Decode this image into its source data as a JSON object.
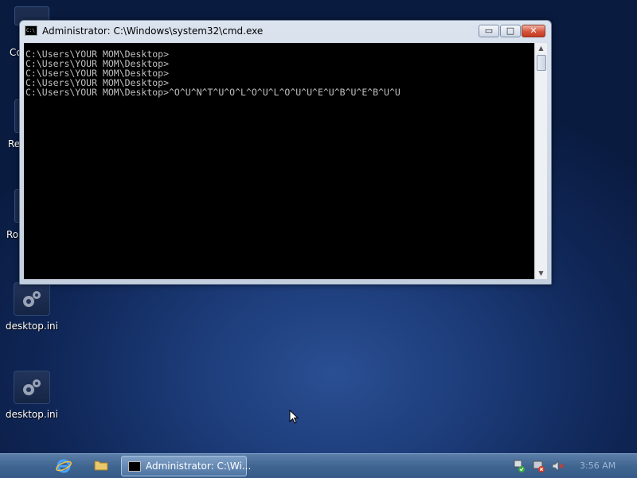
{
  "desktop": {
    "partial_labels": [
      "Co",
      "Re",
      "Ro"
    ],
    "icons": [
      {
        "label": "desktop.ini",
        "icon": "gear-icon"
      },
      {
        "label": "desktop.ini",
        "icon": "gear-icon"
      }
    ]
  },
  "window": {
    "title": "Administrator: C:\\Windows\\system32\\cmd.exe",
    "buttons": {
      "minimize": "▭",
      "maximize": "□",
      "close": "✕"
    },
    "console_lines": [
      "C:\\Users\\YOUR MOM\\Desktop>",
      "C:\\Users\\YOUR MOM\\Desktop>",
      "C:\\Users\\YOUR MOM\\Desktop>",
      "C:\\Users\\YOUR MOM\\Desktop>",
      "C:\\Users\\YOUR MOM\\Desktop>^O^U^N^T^U^O^L^O^U^L^O^U^U^E^U^B^U^E^B^U^U"
    ]
  },
  "taskbar": {
    "task_label": "Administrator: C:\\Wi...",
    "clock": "3:56 AM",
    "quicklaunch": [
      "ie-icon",
      "folder-icon"
    ],
    "tray": [
      "network-icon",
      "security-alert-icon",
      "volume-muted-icon"
    ]
  }
}
